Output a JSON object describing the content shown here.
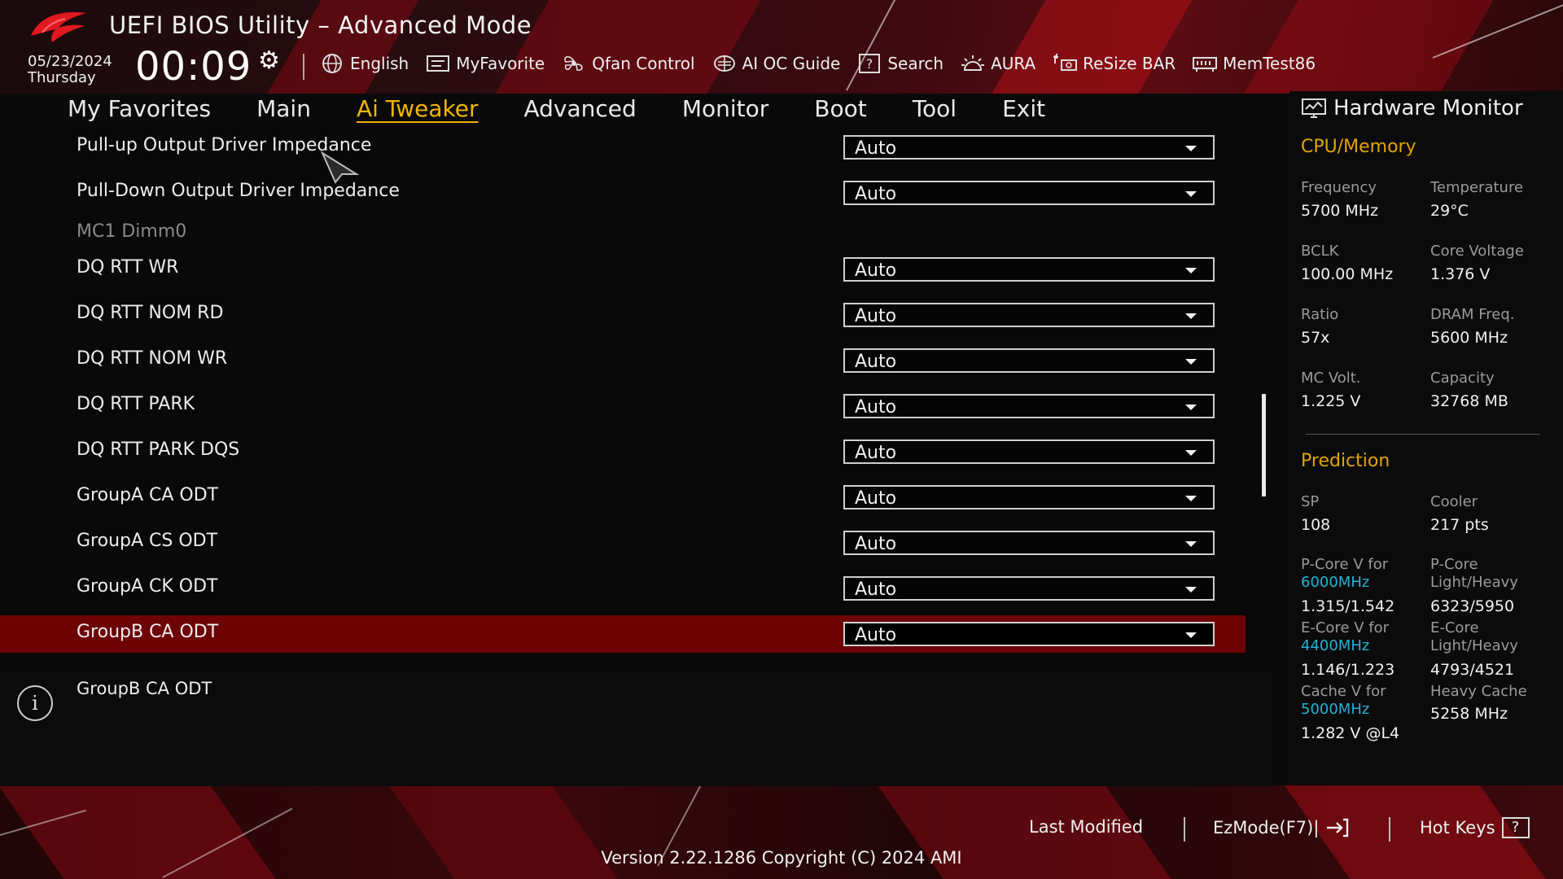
{
  "header": {
    "title": "UEFI BIOS Utility – Advanced Mode",
    "date": "05/23/2024",
    "weekday": "Thursday",
    "time": "00:09",
    "toolbar": [
      {
        "label": "English",
        "icon": "globe-icon"
      },
      {
        "label": "MyFavorite",
        "icon": "favorite-list-icon"
      },
      {
        "label": "Qfan Control",
        "icon": "fan-icon"
      },
      {
        "label": "AI OC Guide",
        "icon": "ai-chip-icon"
      },
      {
        "label": "Search",
        "icon": "question-box-icon"
      },
      {
        "label": "AURA",
        "icon": "aura-light-icon"
      },
      {
        "label": "ReSize BAR",
        "icon": "resize-bar-icon"
      },
      {
        "label": "MemTest86",
        "icon": "memory-module-icon"
      }
    ]
  },
  "tabs": [
    {
      "label": "My Favorites",
      "active": false
    },
    {
      "label": "Main",
      "active": false
    },
    {
      "label": "Ai Tweaker",
      "active": true
    },
    {
      "label": "Advanced",
      "active": false
    },
    {
      "label": "Monitor",
      "active": false
    },
    {
      "label": "Boot",
      "active": false
    },
    {
      "label": "Tool",
      "active": false
    },
    {
      "label": "Exit",
      "active": false
    }
  ],
  "settings": [
    {
      "label": "Pull-up Output Driver Impedance",
      "value": "Auto"
    },
    {
      "label": "Pull-Down Output Driver Impedance",
      "value": "Auto"
    },
    {
      "label": "MC1 Dimm0",
      "value": null
    },
    {
      "label": "DQ RTT WR",
      "value": "Auto"
    },
    {
      "label": "DQ RTT NOM RD",
      "value": "Auto"
    },
    {
      "label": "DQ RTT NOM WR",
      "value": "Auto"
    },
    {
      "label": "DQ RTT PARK",
      "value": "Auto"
    },
    {
      "label": "DQ RTT PARK DQS",
      "value": "Auto"
    },
    {
      "label": "GroupA CA ODT",
      "value": "Auto"
    },
    {
      "label": "GroupA CS ODT",
      "value": "Auto"
    },
    {
      "label": "GroupA CK ODT",
      "value": "Auto"
    },
    {
      "label": "GroupB CA ODT",
      "value": "Auto",
      "selected": true
    }
  ],
  "help": {
    "text": "GroupB CA ODT"
  },
  "hardware_monitor": {
    "title": "Hardware Monitor",
    "cpu_memory": {
      "heading": "CPU/Memory",
      "items": [
        {
          "label": "Frequency",
          "value": "5700 MHz"
        },
        {
          "label": "Temperature",
          "value": "29°C"
        },
        {
          "label": "BCLK",
          "value": "100.00 MHz"
        },
        {
          "label": "Core Voltage",
          "value": "1.376 V"
        },
        {
          "label": "Ratio",
          "value": "57x"
        },
        {
          "label": "DRAM Freq.",
          "value": "5600 MHz"
        },
        {
          "label": "MC Volt.",
          "value": "1.225 V"
        },
        {
          "label": "Capacity",
          "value": "32768 MB"
        }
      ]
    },
    "prediction": {
      "heading": "Prediction",
      "sp_label": "SP",
      "sp_value": "108",
      "cooler_label": "Cooler",
      "cooler_value": "217 pts",
      "pcore_v_label": "P-Core V for",
      "pcore_v_freq": "6000MHz",
      "pcore_v_value": "1.315/1.542",
      "pcore_lh_label_1": "P-Core",
      "pcore_lh_label_2": "Light/Heavy",
      "pcore_lh_value": "6323/5950",
      "ecore_v_label": "E-Core V for",
      "ecore_v_freq": "4400MHz",
      "ecore_v_value": "1.146/1.223",
      "ecore_lh_label_1": "E-Core",
      "ecore_lh_label_2": "Light/Heavy",
      "ecore_lh_value": "4793/4521",
      "cache_v_label": "Cache V for",
      "cache_v_freq": "5000MHz",
      "cache_v_value": "1.282 V @L4",
      "heavy_cache_label": "Heavy Cache",
      "heavy_cache_value": "5258 MHz"
    }
  },
  "footer": {
    "last_modified": "Last Modified",
    "ezmode": "EzMode(F7)|",
    "hotkeys": "Hot Keys",
    "hotkeys_key": "?",
    "version": "Version 2.22.1286 Copyright (C) 2024 AMI"
  },
  "colors": {
    "accent": "#f2b400",
    "selected_row": "#6e0306",
    "prediction_highlight": "#1fb3d6",
    "section_heading": "#e2a400"
  }
}
